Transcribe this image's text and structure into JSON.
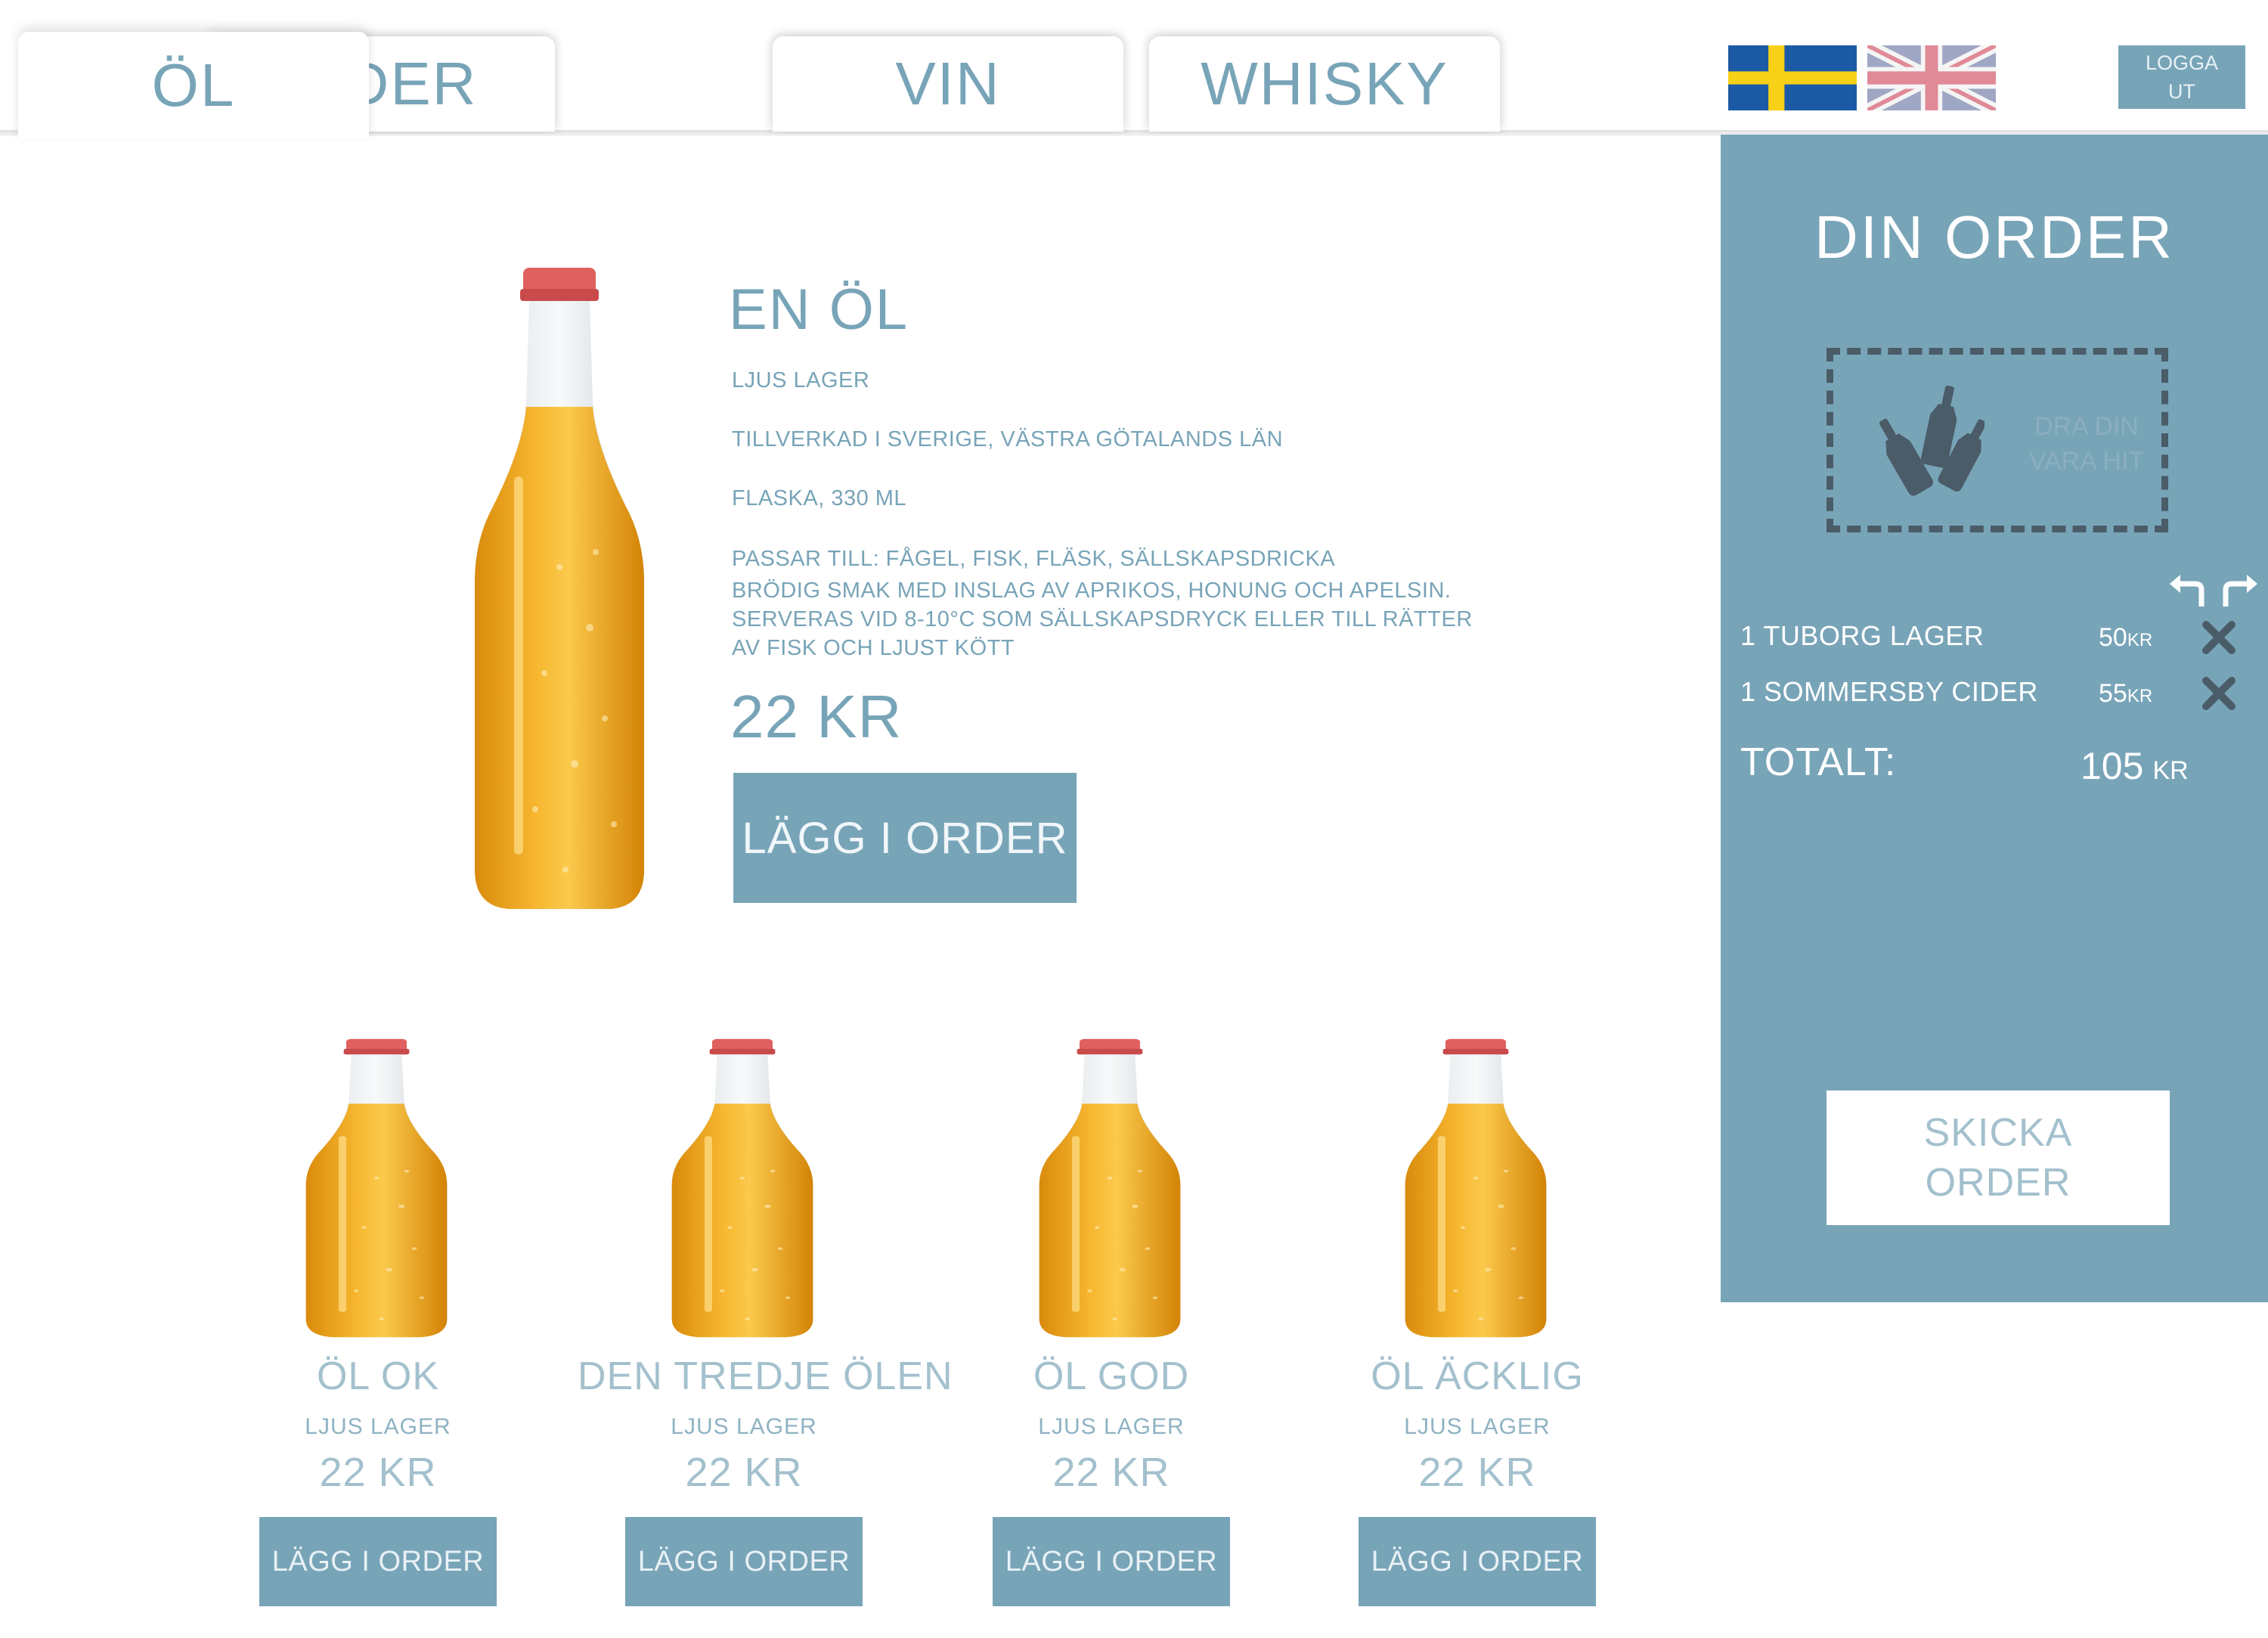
{
  "tabs": [
    {
      "label": "ÖL",
      "active": true
    },
    {
      "label": "CIDER",
      "active": false
    },
    {
      "label": "VIN",
      "active": false
    },
    {
      "label": "WHISKY",
      "active": false
    }
  ],
  "languages": [
    {
      "icon": "swedish-flag-icon",
      "label": "Svenska"
    },
    {
      "icon": "uk-flag-icon",
      "label": "English"
    }
  ],
  "logout": {
    "line1": "LOGGA",
    "line2": "UT"
  },
  "featured": {
    "name": "EN ÖL",
    "style": "LJUS LAGER",
    "origin": "TILLVERKAD I SVERIGE, VÄSTRA GÖTALANDS LÄN",
    "package": "FLASKA, 330 ML",
    "pairs": "PASSAR TILL: FÅGEL, FISK, FLÄSK, SÄLLSKAPSDRICKA",
    "desc1": "BRÖDIG SMAK MED INSLAG AV APRIKOS, HONUNG OCH APELSIN.",
    "desc2": "SERVERAS VID 8-10°C SOM SÄLLSKAPSDRYCK ELLER TILL RÄTTER",
    "desc3": "AV FISK OCH LJUST KÖTT",
    "price": "22 KR",
    "button": "LÄGG I ORDER"
  },
  "products": [
    {
      "name": "ÖL OK",
      "style": "LJUS LAGER",
      "price": "22 KR",
      "button": "LÄGG I ORDER"
    },
    {
      "name": "DEN TREDJE ÖLEN",
      "style": "LJUS LAGER",
      "price": "22 KR",
      "button": "LÄGG I ORDER"
    },
    {
      "name": "ÖL GOD",
      "style": "LJUS LAGER",
      "price": "22 KR",
      "button": "LÄGG I ORDER"
    },
    {
      "name": "ÖL ÄCKLIG",
      "style": "LJUS LAGER",
      "price": "22 KR",
      "button": "LÄGG I ORDER"
    }
  ],
  "order": {
    "title": "DIN ORDER",
    "dropzone_line1": "DRA DIN",
    "dropzone_line2": "VARA HIT",
    "items": [
      {
        "name": "1 TUBORG LAGER",
        "price": "50",
        "unit": "KR"
      },
      {
        "name": "1 SOMMERSBY CIDER",
        "price": "55",
        "unit": "KR"
      }
    ],
    "total_label": "TOTALT:",
    "total_value": "105",
    "total_unit": "KR",
    "send_line1": "SKICKA",
    "send_line2": "ORDER"
  },
  "colors": {
    "accent": "#78a4b8",
    "accent_light": "#a3c0cd",
    "panel_text": "#ffffff",
    "dropzone_border": "#4a5c68",
    "beer": "#f0a824"
  }
}
